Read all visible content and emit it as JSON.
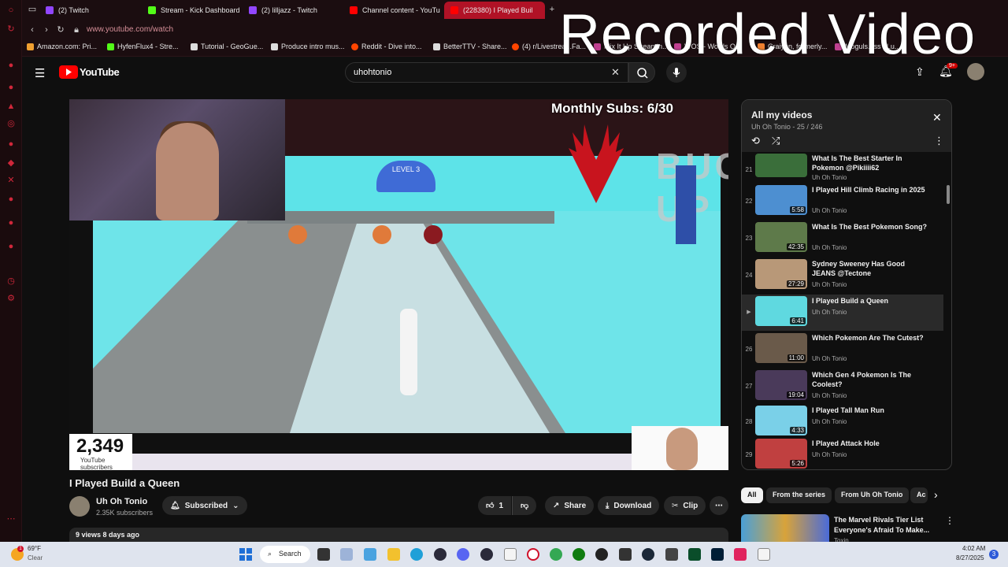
{
  "overlay": {
    "recorded_label": "Recorded Video"
  },
  "tabs": [
    {
      "label": "(2) Twitch",
      "color": "#9146ff"
    },
    {
      "label": "Stream - Kick Dashboard",
      "color": "#53fc18"
    },
    {
      "label": "(2) lilljazz - Twitch",
      "color": "#9146ff"
    },
    {
      "label": "Channel content - YouTu",
      "color": "#ff0000"
    },
    {
      "label": "(228380) I Played Buil",
      "color": "#ff0000"
    }
  ],
  "address": {
    "url": "www.youtube.com/watch"
  },
  "bookmarks": [
    "Amazon.com: Pri...",
    "HyfenFlux4 - Stre...",
    "Tutorial - GeoGue...",
    "Produce intro mus...",
    "Reddit - Dive into...",
    "BetterTTV - Share...",
    "(4) r/Livestrea...Fa...",
    "Mix It Up Streamin...",
    "WOS - Words O...",
    "Craiyon, formerly...",
    "Moguls.ass | Lu..."
  ],
  "youtube": {
    "logo": "YouTube",
    "search_value": "uhohtonio",
    "notification_count": "9+"
  },
  "video": {
    "title": "I Played Build a Queen",
    "monthly_subs": "Monthly Subs: 6/30",
    "bucked_up": "BUCKED UP",
    "level": "LEVEL 3",
    "sub_count": "2,349",
    "sub_count_label": "YouTube subscribers"
  },
  "channel": {
    "name": "Uh Oh Tonio",
    "subscribers": "2.35K subscribers",
    "subscribe_label": "Subscribed"
  },
  "actions": {
    "likes": "1",
    "share": "Share",
    "download": "Download",
    "clip": "Clip"
  },
  "meta": {
    "views_age": "9 views  8 days ago"
  },
  "playlist": {
    "title": "All my videos",
    "subtitle": "Uh Oh Tonio - 25 / 246",
    "items": [
      {
        "idx": "21",
        "title": "What Is The Best Starter In Pokemon @Pikiiii62",
        "channel": "Uh Oh Tonio",
        "duration": "",
        "thumb": "#3a6e3a"
      },
      {
        "idx": "22",
        "title": "I Played Hill Climb Racing in 2025",
        "channel": "Uh Oh Tonio",
        "duration": "5:58",
        "thumb": "#4d8fd1"
      },
      {
        "idx": "23",
        "title": "What Is The Best Pokemon Song?",
        "channel": "Uh Oh Tonio",
        "duration": "42:35",
        "thumb": "#5e7a4a"
      },
      {
        "idx": "24",
        "title": "Sydney Sweeney Has Good JEANS @Tectone",
        "channel": "Uh Oh Tonio",
        "duration": "27:29",
        "thumb": "#b89878"
      },
      {
        "idx": "",
        "title": "I Played Build a Queen",
        "channel": "Uh Oh Tonio",
        "duration": "6:41",
        "thumb": "#5fd9e0"
      },
      {
        "idx": "26",
        "title": "Which Pokemon Are The Cutest?",
        "channel": "Uh Oh Tonio",
        "duration": "11:00",
        "thumb": "#6a5a4a"
      },
      {
        "idx": "27",
        "title": "Which Gen 4 Pokemon Is The Coolest?",
        "channel": "Uh Oh Tonio",
        "duration": "19:04",
        "thumb": "#4a3a5a"
      },
      {
        "idx": "28",
        "title": "I Played Tall Man Run",
        "channel": "Uh Oh Tonio",
        "duration": "4:33",
        "thumb": "#7ad0e8"
      },
      {
        "idx": "29",
        "title": "I Played Attack Hole",
        "channel": "Uh Oh Tonio",
        "duration": "5:26",
        "thumb": "#c04040"
      }
    ]
  },
  "chips": [
    "All",
    "From the series",
    "From Uh Oh Tonio",
    "Ac"
  ],
  "recommended": {
    "title": "The Marvel Rivals Tier List Everyone's Afraid To Make...",
    "channel": "Toxin"
  },
  "taskbar": {
    "temp": "69°F",
    "weather": "Clear",
    "search": "Search",
    "time": "4:02 AM",
    "date": "8/27/2025",
    "notifications": "3"
  }
}
